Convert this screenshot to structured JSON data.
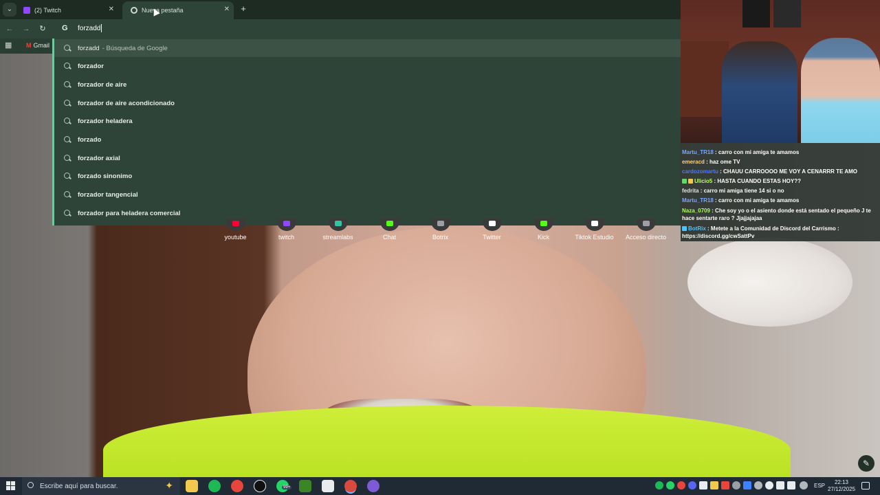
{
  "browser": {
    "tabs": [
      {
        "label": "(2) Twitch",
        "active": false
      },
      {
        "label": "Nueva pestaña",
        "active": true
      }
    ],
    "omnibox": {
      "value": "forzadd"
    },
    "bookmarks": {
      "gmail_label": "Gmail"
    }
  },
  "dropdown": {
    "first": {
      "query": "forzadd",
      "suffix": "- Búsqueda de Google"
    },
    "suggestions": [
      "forzador",
      "forzador de aire",
      "forzador de aire acondicionado",
      "forzador heladera",
      "forzado",
      "forzador axial",
      "forzado sinonimo",
      "forzador tangencial",
      "forzador para heladera comercial"
    ]
  },
  "shortcuts": [
    {
      "label": "youtube",
      "color": "#ff0033"
    },
    {
      "label": "twitch",
      "color": "#9146ff"
    },
    {
      "label": "streamlabs",
      "color": "#31c3a2"
    },
    {
      "label": "Chat",
      "color": "#53fc18"
    },
    {
      "label": "Botrix",
      "color": "#9aa0a6"
    },
    {
      "label": "Twitter",
      "color": "#ffffff"
    },
    {
      "label": "Kick",
      "color": "#53fc18"
    },
    {
      "label": "Tiktok Estudio",
      "color": "#ffffff"
    },
    {
      "label": "Acceso directo",
      "color": "#9aa0a6"
    }
  ],
  "chat": [
    {
      "user": "Martu_TR18",
      "user_color": "#7aa7ff",
      "text": ": carro con mi amiga te amamos"
    },
    {
      "user": "emeracd",
      "user_color": "#ffd27a",
      "text": ": haz ome TV"
    },
    {
      "user": "cardozomartu",
      "user_color": "#4a79ff",
      "text": ": CHAUU CARROOOO ME VOY A CENARRR TE AMO"
    },
    {
      "user": "Ulicio5",
      "user_color": "#b8ff6a",
      "text": ": HASTA CUANDO ESTAS HOY??"
    },
    {
      "user": "fedrita",
      "user_color": "#dfe3e6",
      "text": ": carro mi amiga tiene 14 si o no"
    },
    {
      "user": "Martu_TR18",
      "user_color": "#7aa7ff",
      "text": ": carro con mi amiga te amamos"
    },
    {
      "user": "Naza_0709",
      "user_color": "#a7ff52",
      "text": ": Che soy yo o el asiento donde está sentado el pequeño J te hace sentarte raro ? Jjajjajajaa"
    },
    {
      "user": "BotRix",
      "user_color": "#4fc3ff",
      "text": ": Metete a la Comunidad de Discord del Carrismo : https://discord.gg/cwSattPv"
    }
  ],
  "taskbar": {
    "search_placeholder": "Escribe aquí para buscar.",
    "language": "ESP",
    "time": "22:13",
    "date": "27/12/2025",
    "whatsapp_badge": "99+"
  },
  "colors": {
    "chrome_dark": "#1e2b23",
    "chrome_mid": "#2f4438",
    "accent": "#74c8a0"
  }
}
